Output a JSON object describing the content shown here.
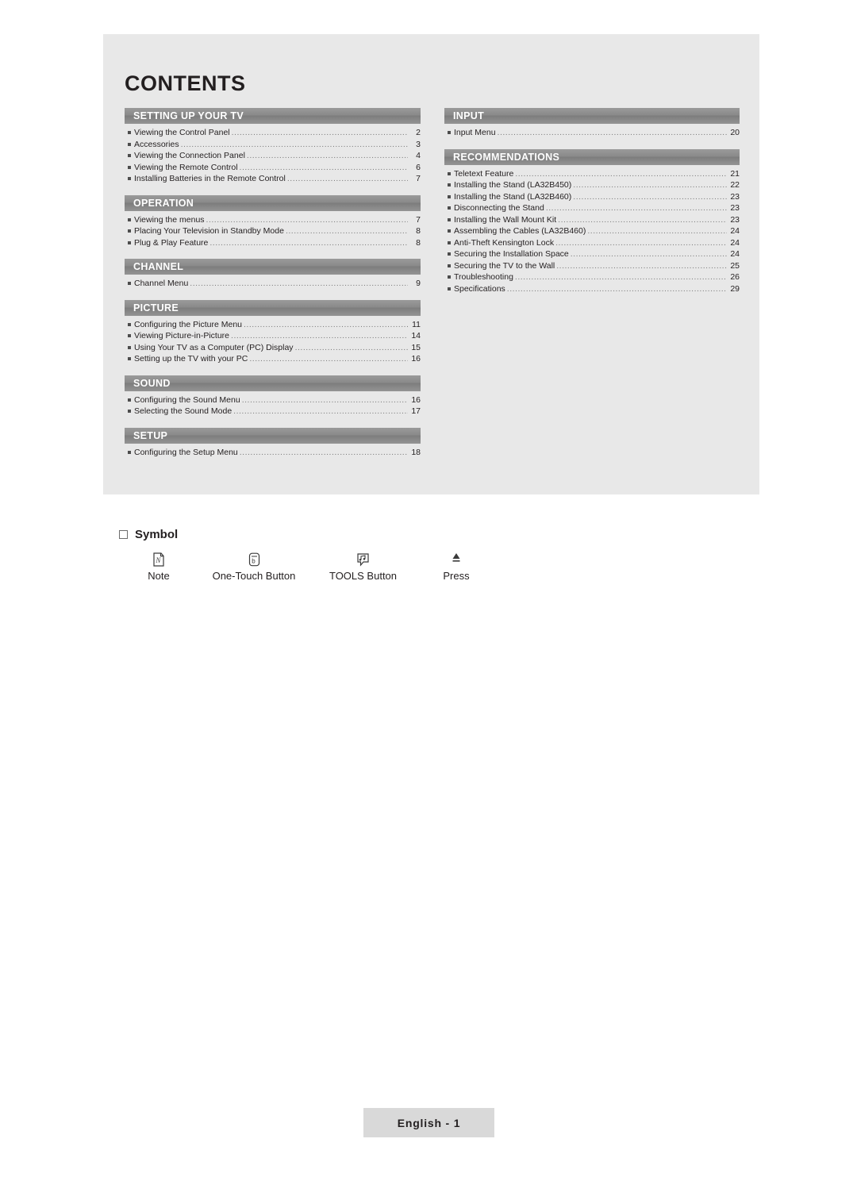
{
  "page": {
    "title": "CONTENTS",
    "footer": "English - 1"
  },
  "contents": {
    "left_sections": [
      {
        "header": "SETTING UP YOUR TV",
        "entries": [
          {
            "text": "Viewing the Control Panel",
            "page": "2"
          },
          {
            "text": "Accessories",
            "page": "3"
          },
          {
            "text": "Viewing the Connection Panel",
            "page": "4"
          },
          {
            "text": "Viewing the Remote Control",
            "page": "6"
          },
          {
            "text": "Installing Batteries in the Remote Control",
            "page": "7"
          }
        ]
      },
      {
        "header": "OPERATION",
        "entries": [
          {
            "text": "Viewing the menus",
            "page": "7"
          },
          {
            "text": "Placing Your Television in Standby Mode",
            "page": "8"
          },
          {
            "text": "Plug & Play Feature",
            "page": "8"
          }
        ]
      },
      {
        "header": "CHANNEL",
        "entries": [
          {
            "text": "Channel Menu",
            "page": "9"
          }
        ]
      },
      {
        "header": "PICTURE",
        "entries": [
          {
            "text": "Configuring the Picture Menu",
            "page": "11"
          },
          {
            "text": "Viewing Picture-in-Picture",
            "page": "14"
          },
          {
            "text": "Using Your TV as a Computer (PC) Display",
            "page": "15"
          },
          {
            "text": "Setting up the TV with your PC",
            "page": "16"
          }
        ]
      },
      {
        "header": "SOUND",
        "entries": [
          {
            "text": "Configuring the Sound Menu",
            "page": "16"
          },
          {
            "text": "Selecting the Sound Mode",
            "page": "17"
          }
        ]
      },
      {
        "header": "SETUP",
        "entries": [
          {
            "text": "Configuring the Setup Menu",
            "page": "18"
          }
        ]
      }
    ],
    "right_sections": [
      {
        "header": "INPUT",
        "entries": [
          {
            "text": "Input Menu",
            "page": "20"
          }
        ]
      },
      {
        "header": "RECOMMENDATIONS",
        "entries": [
          {
            "text": "Teletext Feature",
            "page": "21"
          },
          {
            "text": "Installing the Stand (LA32B450)",
            "page": "22"
          },
          {
            "text": "Installing the Stand (LA32B460)",
            "page": "23"
          },
          {
            "text": "Disconnecting the Stand",
            "page": "23"
          },
          {
            "text": "Installing the Wall Mount Kit",
            "page": "23"
          },
          {
            "text": "Assembling the Cables (LA32B460)",
            "page": "24"
          },
          {
            "text": "Anti-Theft Kensington Lock",
            "page": "24"
          },
          {
            "text": "Securing the Installation Space",
            "page": "24"
          },
          {
            "text": "Securing the TV to the Wall",
            "page": "25"
          },
          {
            "text": "Troubleshooting",
            "page": "26"
          },
          {
            "text": "Specifications",
            "page": "29"
          }
        ]
      }
    ]
  },
  "symbol": {
    "heading": "Symbol",
    "items": [
      {
        "icon": "note-icon",
        "label": "Note"
      },
      {
        "icon": "one-touch-button-icon",
        "label": "One-Touch Button"
      },
      {
        "icon": "tools-button-icon",
        "label": "TOOLS Button"
      },
      {
        "icon": "press-arrow-icon",
        "label": "Press"
      }
    ]
  }
}
